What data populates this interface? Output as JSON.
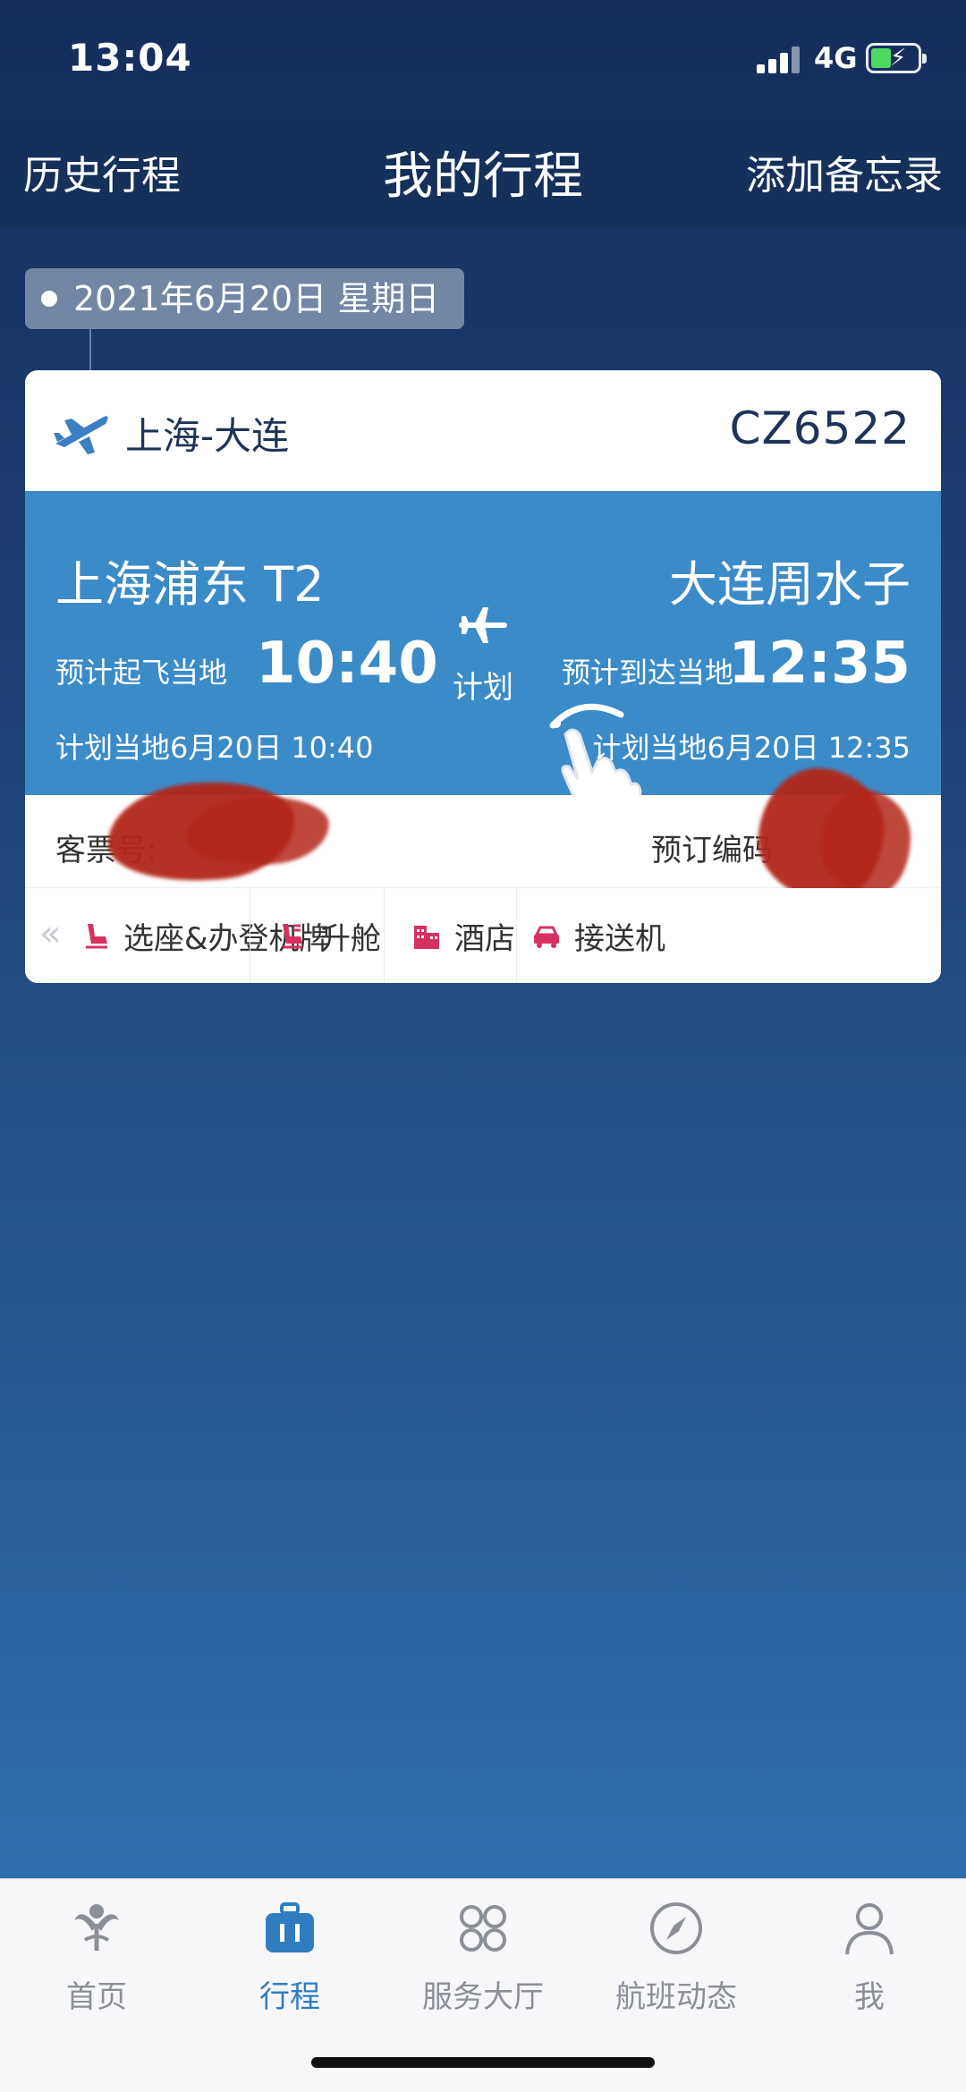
{
  "status_bar": {
    "time": "13:04",
    "network": "4G",
    "battery_color": "#4cd964"
  },
  "nav": {
    "left": "历史行程",
    "title": "我的行程",
    "right": "添加备忘录"
  },
  "date": "2021年6月20日 星期日",
  "trip": {
    "route": "上海-大连",
    "flight_no": "CZ6522",
    "departure": {
      "airport": "上海浦东 T2",
      "time_label": "预计起飞当地",
      "time": "10:40",
      "scheduled": "计划当地6月20日 10:40"
    },
    "arrival": {
      "airport": "大连周水子",
      "time_label": "预计到达当地",
      "time": "12:35",
      "scheduled": "计划当地6月20日 12:35"
    },
    "status": "计划",
    "ticket_label": "客票号:",
    "booking_label": "预订编码",
    "actions": [
      {
        "label": "选座&办登机牌",
        "icon": "seat-icon"
      },
      {
        "label": "升舱",
        "icon": "upgrade-seat-icon"
      },
      {
        "label": "酒店",
        "icon": "hotel-icon"
      },
      {
        "label": "接送机",
        "icon": "car-icon"
      }
    ],
    "accent_color": "#3c8bc9",
    "action_icon_color": "#d6315f"
  },
  "tabs": [
    {
      "label": "首页",
      "icon": "home-logo-icon",
      "active": false
    },
    {
      "label": "行程",
      "icon": "luggage-icon",
      "active": true
    },
    {
      "label": "服务大厅",
      "icon": "service-grid-icon",
      "active": false
    },
    {
      "label": "航班动态",
      "icon": "compass-icon",
      "active": false
    },
    {
      "label": "我",
      "icon": "person-icon",
      "active": false
    }
  ]
}
